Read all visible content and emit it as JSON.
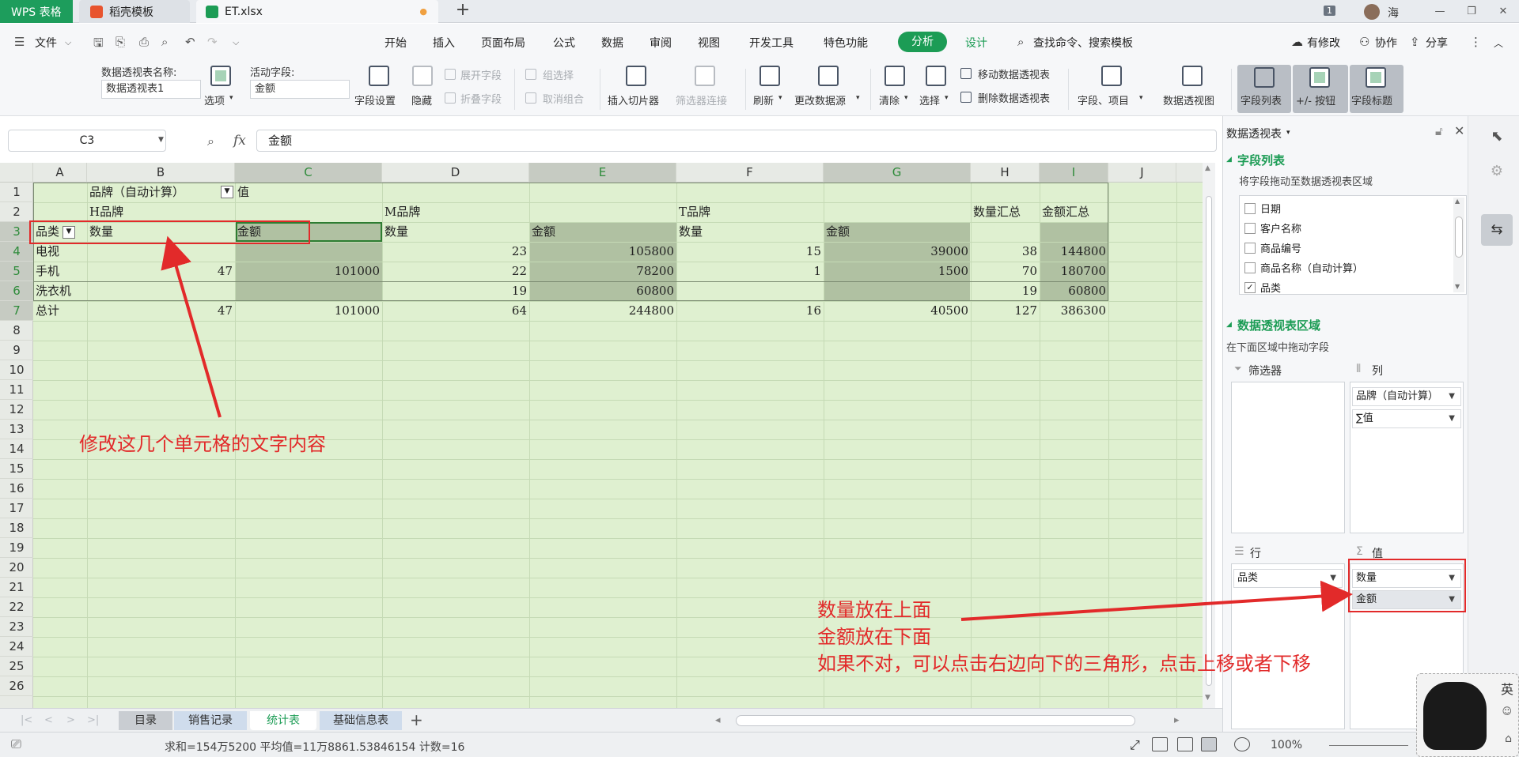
{
  "titlebar": {
    "tabs": [
      {
        "label": "WPS 表格"
      },
      {
        "label": "稻壳模板"
      },
      {
        "label": "ET.xlsx"
      }
    ],
    "window_badge": "1",
    "user_name": "海"
  },
  "menubar": {
    "file_label": "文件",
    "items": [
      "开始",
      "插入",
      "页面布局",
      "公式",
      "数据",
      "审阅",
      "视图",
      "开发工具",
      "特色功能",
      "分析",
      "设计"
    ],
    "search_label": "查找命令、搜索模板",
    "right": [
      "有修改",
      "协作",
      "分享"
    ]
  },
  "ribbon": {
    "pivot_name_label": "数据透视表名称:",
    "pivot_name_value": "数据透视表1",
    "options_label": "选项",
    "active_field_label": "活动字段:",
    "active_field_value": "金额",
    "field_settings": "字段设置",
    "hide": "隐藏",
    "expand_field": "展开字段",
    "collapse_field": "折叠字段",
    "group_selection": "组选择",
    "ungroup": "取消组合",
    "insert_slicer": "插入切片器",
    "filter_connections": "筛选器连接",
    "refresh": "刷新",
    "change_source": "更改数据源",
    "clear": "清除",
    "select": "选择",
    "move_pivot": "移动数据透视表",
    "delete_pivot": "删除数据透视表",
    "fields_items": "字段、项目",
    "pivot_chart": "数据透视图",
    "field_list": "字段列表",
    "plus_minus": "+/- 按钮",
    "field_headers": "字段标题"
  },
  "formulabar": {
    "cell_ref": "C3",
    "fx": "fx",
    "content": "金额"
  },
  "sheet": {
    "columns": [
      "A",
      "B",
      "C",
      "D",
      "E",
      "F",
      "G",
      "H",
      "I",
      "J"
    ],
    "selected_columns": [
      "C",
      "E",
      "G",
      "I"
    ],
    "rows": [
      "1",
      "2",
      "3",
      "4",
      "5",
      "6",
      "7",
      "8",
      "9",
      "10",
      "11",
      "12",
      "13",
      "14",
      "15",
      "16",
      "17",
      "18",
      "19",
      "20",
      "21",
      "22",
      "23",
      "24",
      "25",
      "26"
    ],
    "cells": {
      "B1": "品牌（自动计算）",
      "C1": "值",
      "B2": "H品牌",
      "D2": "M品牌",
      "F2": "T品牌",
      "H2": "数量汇总",
      "I2": "金额汇总",
      "A3": "品类",
      "B3": "数量",
      "C3": "金额",
      "D3": "数量",
      "E3": "金额",
      "F3": "数量",
      "G3": "金额",
      "A4": "电视",
      "D4": "23",
      "E4": "105800",
      "F4": "15",
      "G4": "39000",
      "H4": "38",
      "I4": "144800",
      "A5": "手机",
      "B5": "47",
      "C5": "101000",
      "D5": "22",
      "E5": "78200",
      "F5": "1",
      "G5": "1500",
      "H5": "70",
      "I5": "180700",
      "A6": "洗衣机",
      "D6": "19",
      "E6": "60800",
      "H6": "19",
      "I6": "60800",
      "A7": "总计",
      "B7": "47",
      "C7": "101000",
      "D7": "64",
      "E7": "244800",
      "F7": "16",
      "G7": "40500",
      "H7": "127",
      "I7": "386300"
    }
  },
  "sheettabs": [
    "目录",
    "销售记录",
    "统计表",
    "基础信息表"
  ],
  "active_sheet": "统计表",
  "statusbar": {
    "summary": "求和=154万5200  平均值=11万8861.53846154  计数=16",
    "zoom": "100%"
  },
  "pane": {
    "title": "数据透视表",
    "field_list_heading": "字段列表",
    "field_list_hint": "将字段拖动至数据透视表区域",
    "fields": [
      {
        "label": "日期",
        "checked": false
      },
      {
        "label": "客户名称",
        "checked": false
      },
      {
        "label": "商品编号",
        "checked": false
      },
      {
        "label": "商品名称（自动计算）",
        "checked": false
      },
      {
        "label": "品类",
        "checked": true
      }
    ],
    "areas_heading": "数据透视表区域",
    "areas_hint": "在下面区域中拖动字段",
    "filter_label": "筛选器",
    "columns_label": "列",
    "rows_label": "行",
    "values_label": "值",
    "column_items": [
      "品牌（自动计算）",
      "∑值"
    ],
    "row_items": [
      "品类"
    ],
    "value_items": [
      "数量",
      "金额"
    ]
  },
  "annotations": {
    "left_note": "修改这几个单元格的文字内容",
    "right_note_1": "数量放在上面",
    "right_note_2": "金额放在下面",
    "right_note_3": "如果不对，可以点击右边向下的三角形，点击上移或者下移"
  },
  "colors": {
    "accent": "#1c9c55",
    "annotation": "#e22a2a",
    "sheet_bg": "#dff0d0"
  }
}
